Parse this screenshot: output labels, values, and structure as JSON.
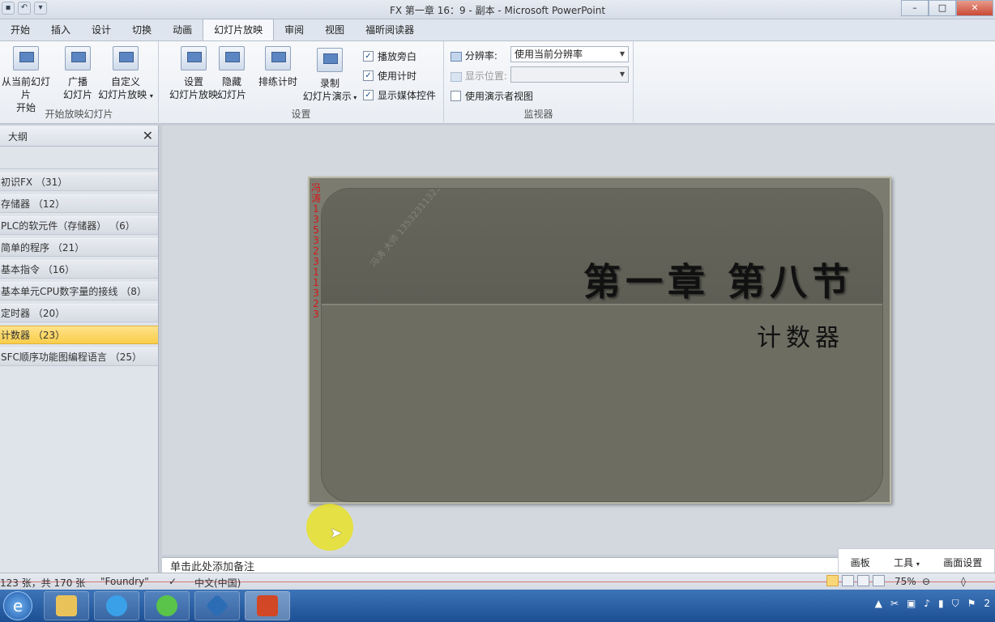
{
  "window": {
    "title": "FX 第一章 16：9 - 副本 - Microsoft PowerPoint"
  },
  "tabs": [
    "开始",
    "插入",
    "设计",
    "切换",
    "动画",
    "幻灯片放映",
    "审阅",
    "视图",
    "福昕阅读器"
  ],
  "ribbon": {
    "start_group": {
      "label": "开始放映幻灯片",
      "from_current": [
        "从当前幻灯片",
        "开始"
      ],
      "broadcast": [
        "广播",
        "幻灯片"
      ],
      "custom": [
        "自定义",
        "幻灯片放映"
      ]
    },
    "setup_group": {
      "label": "设置",
      "setup": [
        "设置",
        "幻灯片放映"
      ],
      "hide": [
        "隐藏",
        "幻灯片"
      ],
      "rehearse": "排练计时",
      "record": [
        "录制",
        "幻灯片演示"
      ],
      "checks": [
        {
          "label": "播放旁白",
          "checked": true
        },
        {
          "label": "使用计时",
          "checked": true
        },
        {
          "label": "显示媒体控件",
          "checked": true
        }
      ]
    },
    "monitor_group": {
      "label": "监视器",
      "resolution_label": "分辨率:",
      "resolution_value": "使用当前分辨率",
      "display_label": "显示位置:",
      "display_value": "",
      "presenter_view": "使用演示者视图"
    }
  },
  "left_pane": {
    "tab": "大纲",
    "sections": [
      {
        "label": "初识FX （31）"
      },
      {
        "label": "存储器 （12）"
      },
      {
        "label": "PLC的软元件（存储器） （6）"
      },
      {
        "label": "简单的程序 （21）"
      },
      {
        "label": "基本指令 （16）"
      },
      {
        "label": "基本单元CPU数字量的接线 （8）"
      },
      {
        "label": "定时器 （20）"
      },
      {
        "label": "计数器 （23）"
      },
      {
        "label": "SFC顺序功能图编程语言 （25）"
      }
    ]
  },
  "slide": {
    "title": "第一章 第八节",
    "subtitle": "计数器",
    "side_text": "冯涛 13532311323",
    "stamp": "冯涛 大师 13532311323"
  },
  "notes": {
    "placeholder": "单击此处添加备注"
  },
  "popover": [
    "画板",
    "工具",
    "画面设置"
  ],
  "status": {
    "slide_count": "123 张，共 170 张",
    "theme": "\"Foundry\"",
    "language": "中文(中国)",
    "zoom": "75%"
  },
  "colors": {
    "selected_section": "#f9ce4a",
    "taskbar": "#1c4f93",
    "slide_bg": "#6d6d62"
  }
}
